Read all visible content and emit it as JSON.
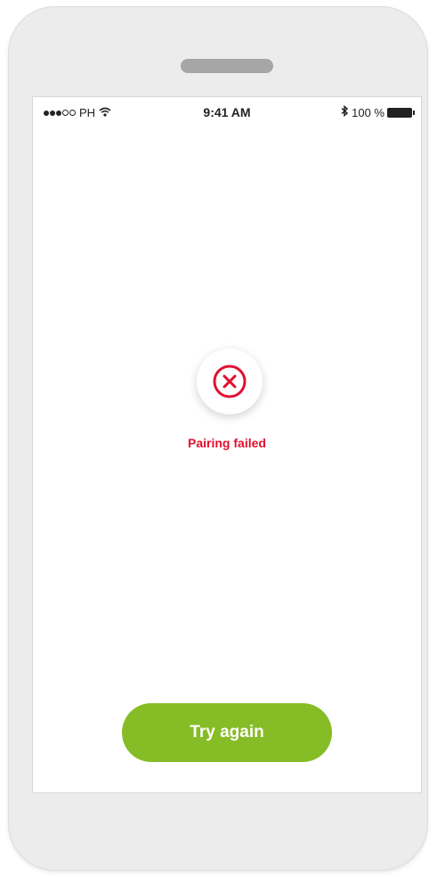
{
  "status_bar": {
    "carrier": "PH",
    "time": "9:41 AM",
    "battery": "100 %"
  },
  "error": {
    "icon": "x-circle-icon",
    "message": "Pairing failed"
  },
  "actions": {
    "try_again_label": "Try again"
  },
  "colors": {
    "error_red": "#e0102f",
    "button_green": "#86bc25"
  }
}
